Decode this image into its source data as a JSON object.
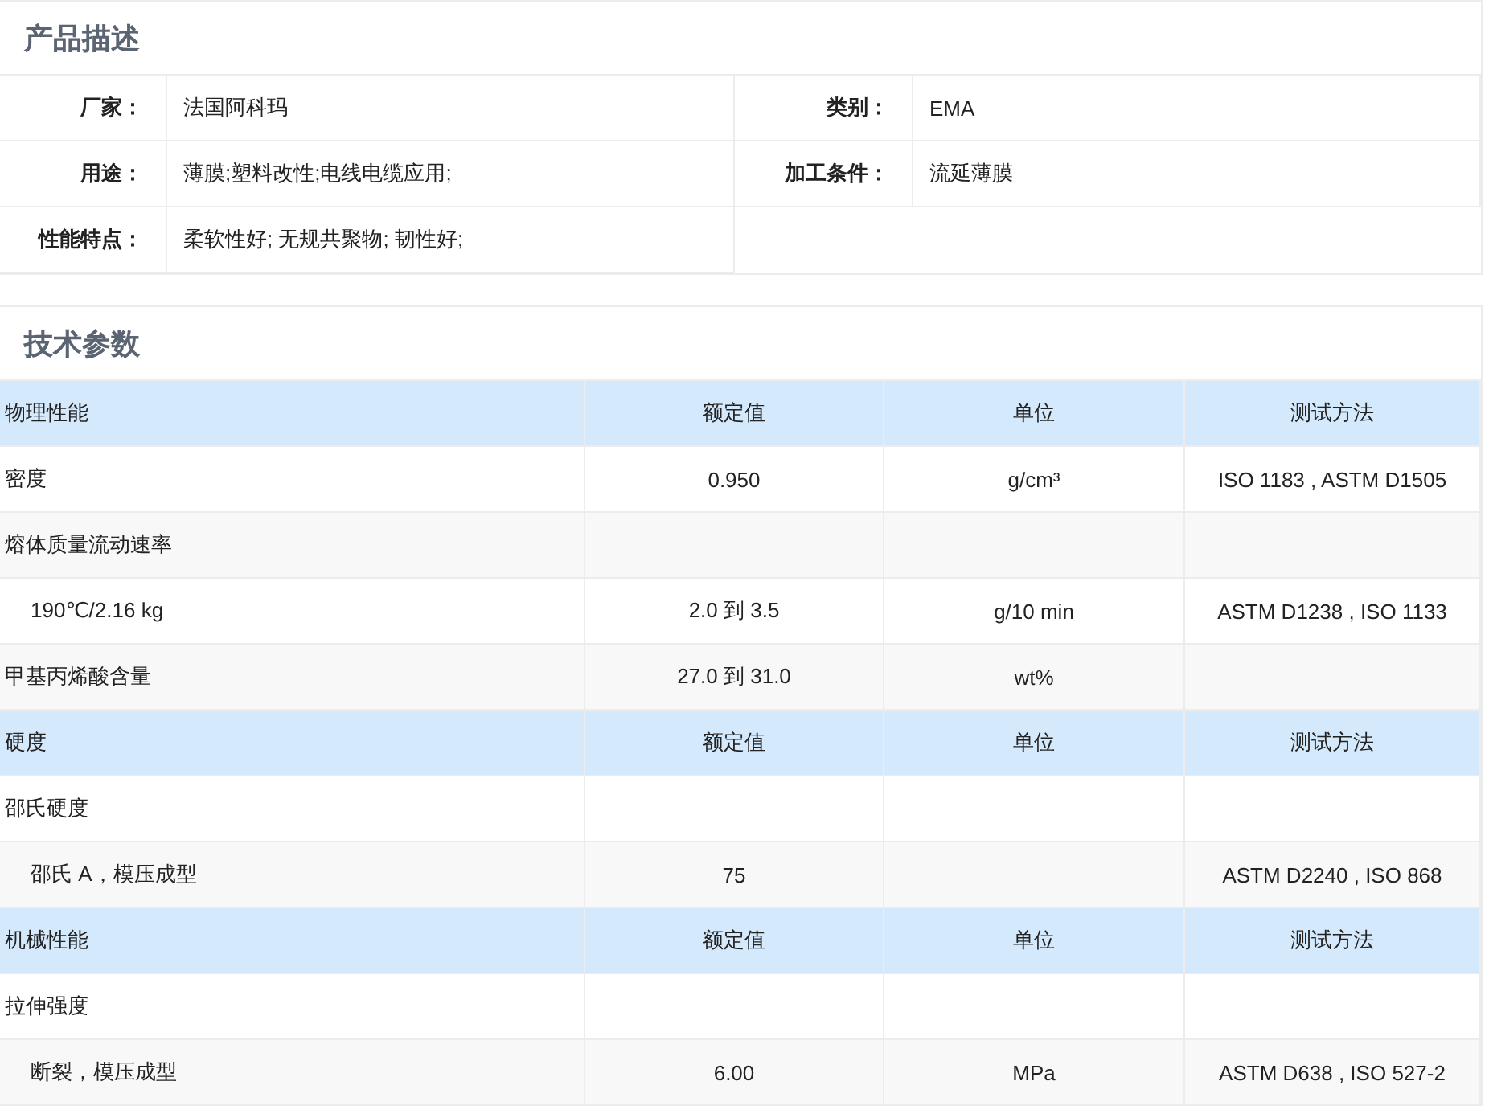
{
  "description": {
    "title": "产品描述",
    "rows": [
      [
        {
          "label": "厂家：",
          "value": "法国阿科玛"
        },
        {
          "label": "类别：",
          "value": "EMA"
        }
      ],
      [
        {
          "label": "用途：",
          "value": "薄膜;塑料改性;电线电缆应用;"
        },
        {
          "label": "加工条件：",
          "value": "流延薄膜"
        }
      ],
      [
        {
          "label": "性能特点：",
          "value": "柔软性好; 无规共聚物; 韧性好;"
        }
      ]
    ]
  },
  "specs": {
    "title": "技术参数",
    "sections": [
      {
        "header": [
          "物理性能",
          "额定值",
          "单位",
          "测试方法"
        ],
        "rows": [
          {
            "kind": "item",
            "cells": [
              "密度",
              "0.950",
              "g/cm³",
              "ISO 1183 , ASTM D1505"
            ]
          },
          {
            "kind": "item",
            "cells": [
              "熔体质量流动速率",
              "",
              "",
              ""
            ]
          },
          {
            "kind": "sub",
            "cells": [
              "190℃/2.16 kg",
              "2.0 到 3.5",
              "g/10 min",
              "ASTM D1238 , ISO 1133"
            ]
          },
          {
            "kind": "item",
            "cells": [
              "甲基丙烯酸含量",
              "27.0 到 31.0",
              "wt%",
              ""
            ]
          }
        ]
      },
      {
        "header": [
          "硬度",
          "额定值",
          "单位",
          "测试方法"
        ],
        "rows": [
          {
            "kind": "item",
            "cells": [
              "邵氏硬度",
              "",
              "",
              ""
            ]
          },
          {
            "kind": "sub",
            "cells": [
              "邵氏 A，模压成型",
              "75",
              "",
              "ASTM D2240 , ISO 868"
            ]
          }
        ]
      },
      {
        "header": [
          "机械性能",
          "额定值",
          "单位",
          "测试方法"
        ],
        "rows": [
          {
            "kind": "item",
            "cells": [
              "拉伸强度",
              "",
              "",
              ""
            ]
          },
          {
            "kind": "sub",
            "cells": [
              "断裂，模压成型",
              "6.00",
              "MPa",
              "ASTM D638 , ISO 527-2"
            ]
          }
        ]
      }
    ]
  }
}
